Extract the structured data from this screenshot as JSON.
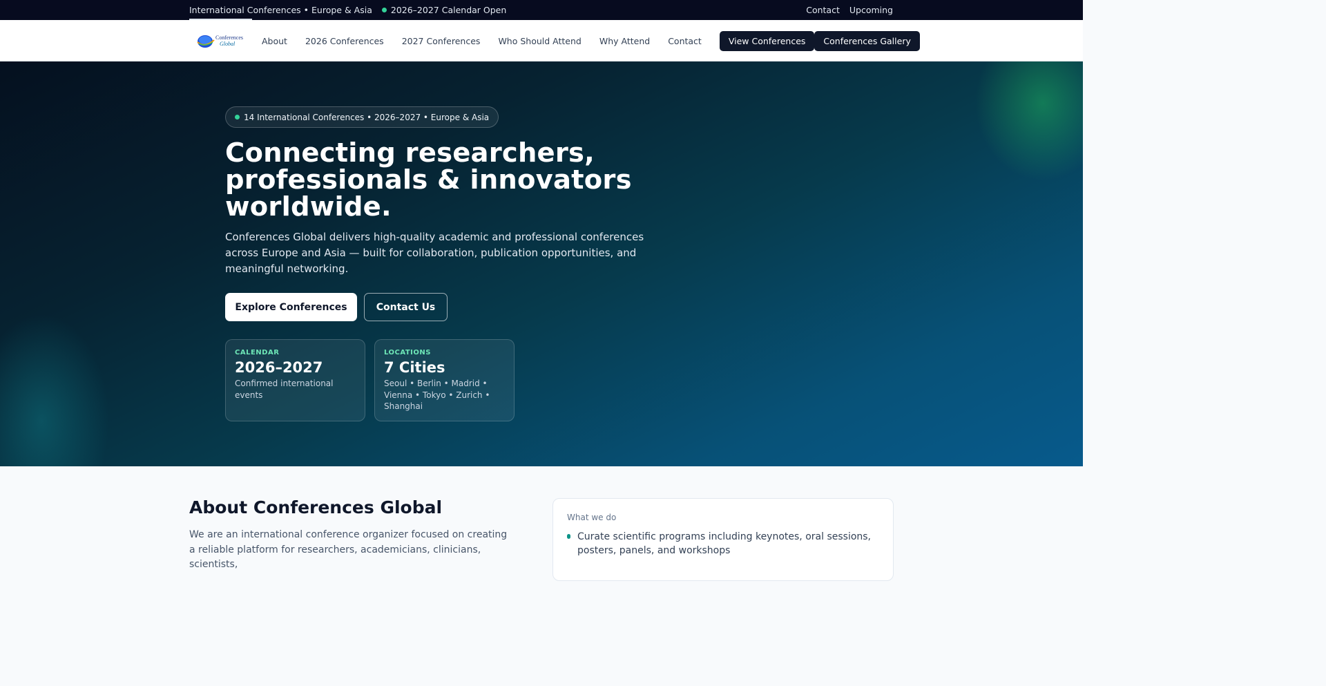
{
  "topbar": {
    "tagline": "International Conferences • Europe & Asia",
    "calendar_status": "2026–2027 Calendar Open",
    "links": [
      "Contact",
      "Upcoming"
    ]
  },
  "nav": {
    "logo_text_top": "Conferences",
    "logo_text_bottom": "Global",
    "links": [
      "About",
      "2026 Conferences",
      "2027 Conferences",
      "Who Should Attend",
      "Why Attend",
      "Contact"
    ],
    "primary_button": "View Conferences",
    "secondary_button": "Conferences Gallery"
  },
  "hero": {
    "pill": "14 International Conferences • 2026–2027 • Europe & Asia",
    "title_line1": "Connecting researchers,",
    "title_line2": "professionals & innovators",
    "title_line3": "worldwide.",
    "lede": "Conferences Global delivers high-quality academic and professional conferences across Europe and Asia — built for collaboration, publication opportunities, and meaningful networking.",
    "cta_primary": "Explore Conferences",
    "cta_secondary": "Contact Us",
    "cards": [
      {
        "label": "CALENDAR",
        "value": "2026–2027",
        "desc": "Confirmed international events"
      },
      {
        "label": "LOCATIONS",
        "value": "7 Cities",
        "desc": "Seoul • Berlin • Madrid • Vienna • Tokyo • Zurich • Shanghai"
      }
    ]
  },
  "about": {
    "title": "About Conferences Global",
    "paragraph": "We are an international conference organizer focused on creating a reliable platform for researchers, academicians, clinicians, scientists,",
    "panel_title": "What we do",
    "panel_items": [
      "Curate scientific programs including keynotes, oral sessions, posters, panels, and workshops"
    ]
  },
  "colors": {
    "topbar_bg": "#070b1f",
    "nav_button_bg": "#0f172a",
    "accent_green": "#34d399",
    "hero_gradient_end": "#075a8c"
  }
}
